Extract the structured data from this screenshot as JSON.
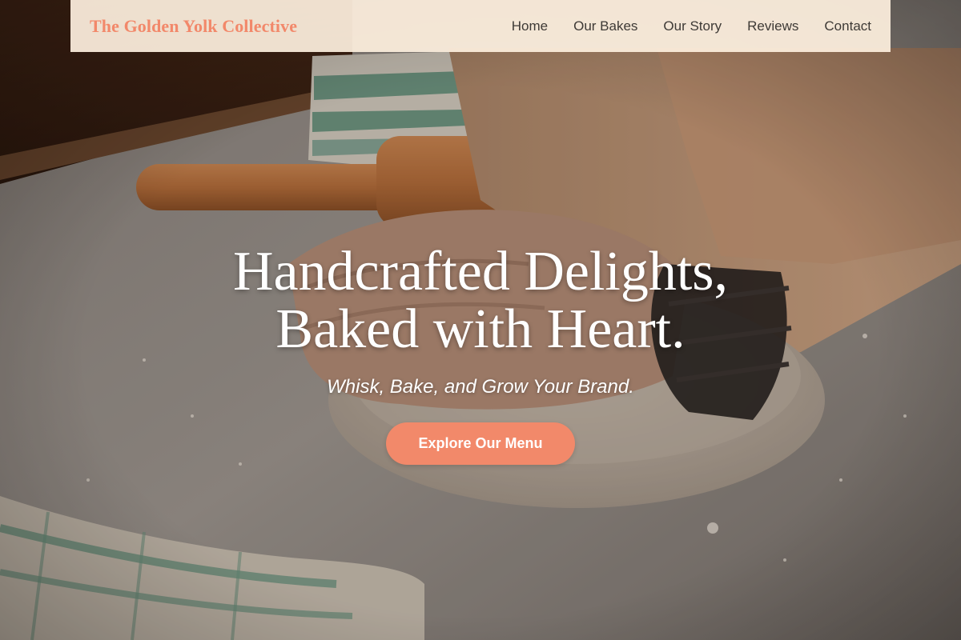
{
  "header": {
    "brand": "The Golden Yolk Collective",
    "nav": [
      {
        "label": "Home"
      },
      {
        "label": "Our Bakes"
      },
      {
        "label": "Our Story"
      },
      {
        "label": "Reviews"
      },
      {
        "label": "Contact"
      }
    ]
  },
  "hero": {
    "title_line_1": "Handcrafted Delights,",
    "title_line_2": "Baked with Heart.",
    "subtitle": "Whisk, Bake, and Grow Your Brand.",
    "cta_label": "Explore Our Menu",
    "background_image": "hands-kneading-dough-photo"
  },
  "colors": {
    "accent": "#f2896a",
    "navbar_bg": "#fdefde",
    "nav_text": "#3e3a36",
    "hero_text": "#ffffff"
  }
}
